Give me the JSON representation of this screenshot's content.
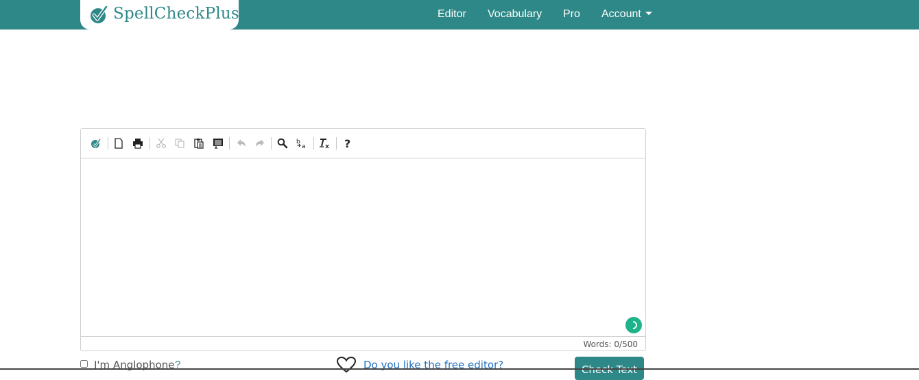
{
  "brand": {
    "name": "SpellCheckPlus",
    "color": "#2e8887"
  },
  "nav": {
    "items": [
      {
        "label": "Editor"
      },
      {
        "label": "Vocabulary"
      },
      {
        "label": "Pro"
      },
      {
        "label": "Account",
        "dropdown": true
      }
    ]
  },
  "toolbar": {
    "buttons": [
      "spellcheck-icon",
      "new-document-icon",
      "print-icon",
      "cut-icon",
      "copy-icon",
      "paste-icon",
      "paste-text-icon",
      "undo-icon",
      "redo-icon",
      "find-icon",
      "replace-icon",
      "remove-format-icon",
      "help-icon"
    ]
  },
  "editor": {
    "text": "",
    "word_count_label": "Words: 0/500"
  },
  "footer": {
    "anglophone_label": "I'm Anglophone",
    "anglophone_help": "?",
    "like_link": "Do you like the free editor?",
    "check_button": "Check Text"
  },
  "colors": {
    "accent": "#2e8887",
    "link": "#1f6fbf",
    "status_dot": "#1eb38a"
  }
}
